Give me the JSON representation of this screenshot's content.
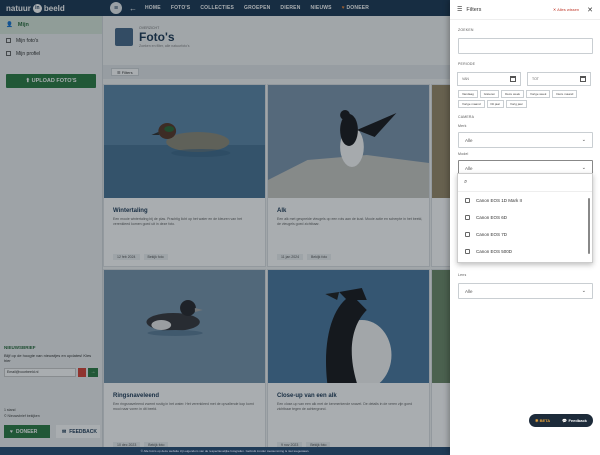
{
  "nav": {
    "logo_left": "natuur",
    "logo_mid": "in",
    "logo_right": "beeld",
    "links": [
      "HOME",
      "FOTO'S",
      "COLLECTIES",
      "GROEPEN",
      "DIEREN",
      "NIEUWS"
    ],
    "doneer": "DONEER"
  },
  "sidebar": {
    "section": "Mijn",
    "items": [
      "Mijn foto's",
      "Mijn profiel"
    ],
    "upload": "UPLOAD FOTO'S",
    "newsletter_title": "NIEUWSBRIEF",
    "newsletter_text": "Blijf op de hoogte van nieuwtjes en updates! Kies hier",
    "newsletter_placeholder": "Email@voorbeeld.nl",
    "stat1": "1 stand",
    "stat2": "© Nieuwsbrief bekijken",
    "doneer_btn": "DONEER",
    "feedback_btn": "FEEDBACK"
  },
  "main": {
    "eyebrow": "OVERZICHT",
    "title": "Foto's",
    "subtitle": "Zoeken en filter, alle natuurfoto's",
    "filters_chip": "Filters",
    "cards": [
      {
        "title": "Wintertaling",
        "desc": "Een mooie wintertaling bij de plas. Prachtig licht op het water en de kleuren van het verenkleed komen goed uit in deze foto.",
        "date": "12 feb 2024",
        "action": "Bekijk foto"
      },
      {
        "title": "Alk",
        "desc": "Een alk met gespreide vleugels op een rots aan de kust. Mooie actie en scherpte in het beeld, de vleugels goed zichtbaar.",
        "date": "11 jan 2024",
        "action": "Bekijk foto"
      },
      {
        "title": "Ringsnaveleend",
        "desc": "Een ringsnaveleend zwemt rustig in het water. Het verenkleed met de opvallende kop komt mooi naar voren in dit beeld.",
        "date": "10 dec 2023",
        "action": "Bekijk foto"
      },
      {
        "title": "Close-up van een alk",
        "desc": "Een close-up van een alk met de kenmerkende snavel. De details in de veren zijn goed zichtbaar tegen de achtergrond.",
        "date": "9 nov 2023",
        "action": "Bekijk foto"
      }
    ]
  },
  "panel": {
    "title": "Filters",
    "clear": "Alles wissen",
    "zoeken_label": "ZOEKEN",
    "periode_label": "PERIODE",
    "van": "VAN",
    "tot": "TOT",
    "period_chips": [
      "Vandaag",
      "Gisteren",
      "Deze week",
      "Vorige week",
      "Deze maand",
      "Vorige maand",
      "Dit jaar",
      "Vorig jaar"
    ],
    "camera_label": "CAMERA",
    "merk_label": "Merk",
    "merk_value": "Alle",
    "model_label": "Model",
    "model_value": "Alle",
    "options": [
      "Canon EOS 1D Mark II",
      "Canon EOS 6D",
      "Canon EOS 7D",
      "Canon EOS 500D"
    ],
    "lens_label": "Lens",
    "lens_value": "Alle",
    "beta": "BETA",
    "feedback": "Feedback"
  },
  "footer": "© Alle foto's op deze website zijn eigendom van de respectievelijke fotografen. Gebruik zonder toestemming is niet toegestaan.",
  "colors": {
    "nav": "#1f3b57",
    "green": "#2e7d45",
    "accent": "#e8833a",
    "danger": "#c0392b"
  }
}
